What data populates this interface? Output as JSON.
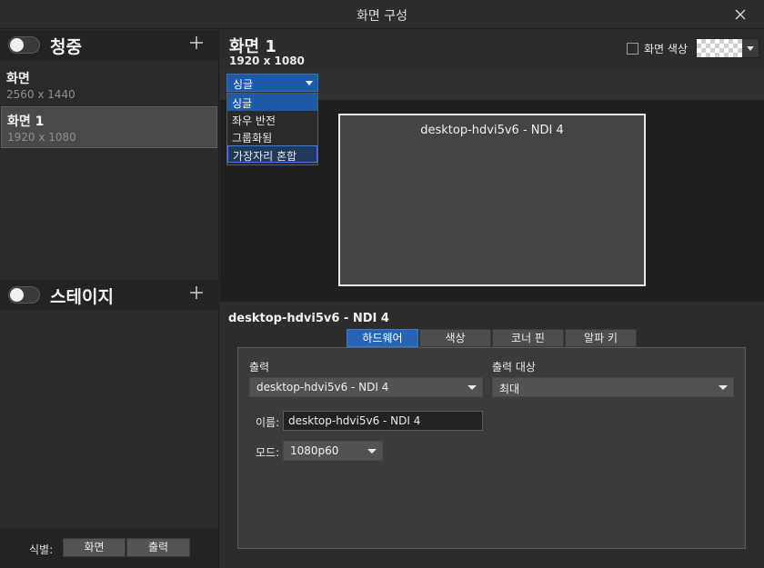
{
  "window": {
    "title": "화면 구성"
  },
  "audience": {
    "title": "청중"
  },
  "stage": {
    "title": "스테이지"
  },
  "scenes": [
    {
      "name": "화면",
      "resolution": "2560 x 1440"
    },
    {
      "name": "화면 1",
      "resolution": "1920 x 1080"
    }
  ],
  "identify": {
    "label": "식별:",
    "screen_button": "화면",
    "output_button": "출력"
  },
  "screen": {
    "title": "화면 1",
    "resolution": "1920 x 1080",
    "background_color_label": "화면 색상",
    "layout_selected": "싱글",
    "layout_options": [
      "싱글",
      "좌우 반전",
      "그룹화됨",
      "가장자리 혼합"
    ]
  },
  "preview": {
    "monitor_label": "desktop-hdvi5v6 - NDI 4"
  },
  "properties": {
    "title": "desktop-hdvi5v6 - NDI 4",
    "tabs": [
      "하드웨어",
      "색상",
      "코너 핀",
      "알파 키"
    ],
    "output_label": "출력",
    "output_value": "desktop-hdvi5v6 - NDI 4",
    "output_target_label": "출력 대상",
    "output_target_value": "최대",
    "name_label": "이름:",
    "name_value": "desktop-hdvi5v6 - NDI 4",
    "mode_label": "모드:",
    "mode_value": "1080p60"
  },
  "colors": {
    "accent": "#2764b4",
    "background": "#2b2b2b"
  }
}
